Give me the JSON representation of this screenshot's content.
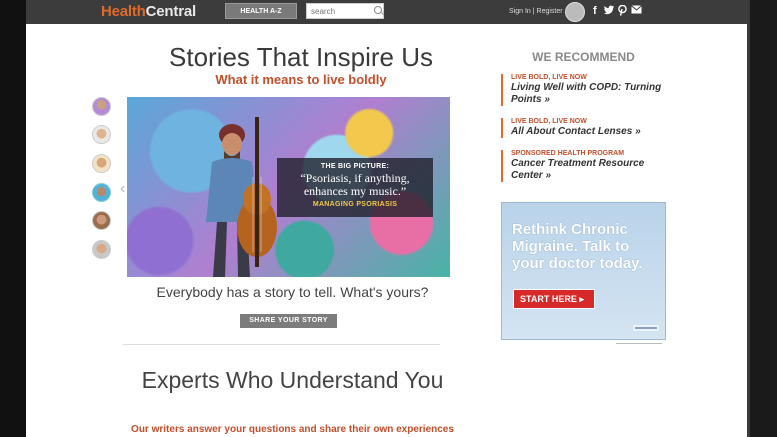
{
  "header": {
    "logo_part1": "Health",
    "logo_part2": "Central",
    "health_az_label": "HEALTH A-Z",
    "search_placeholder": "search",
    "signin_label": "Sign In",
    "separator": "|",
    "register_label": "Register",
    "social_icons": [
      "facebook-icon",
      "twitter-icon",
      "pinterest-icon",
      "email-icon"
    ]
  },
  "stories": {
    "title": "Stories That Inspire Us",
    "subtitle": "What it means to live boldly",
    "hero": {
      "kicker": "THE BIG PICTURE:",
      "quote": "“Psoriasis, if anything, enhances my music.”",
      "tag": "MANAGING PSORIASIS"
    },
    "tagline": "Everybody has a story to tell. What's yours?",
    "share_label": "SHARE YOUR STORY"
  },
  "experts": {
    "title": "Experts Who Understand You",
    "subtitle": "Our writers answer your questions and share their own experiences"
  },
  "recommend": {
    "title": "WE RECOMMEND",
    "items": [
      {
        "kicker": "LIVE BOLD, LIVE NOW",
        "link": "Living Well with COPD: Turning Points »"
      },
      {
        "kicker": "LIVE BOLD, LIVE NOW",
        "link": "All About Contact Lenses »"
      },
      {
        "kicker": "SPONSORED HEALTH PROGRAM",
        "link": "Cancer Treatment Resource Center »"
      }
    ]
  },
  "ad": {
    "headline": "Rethink Chronic Migraine. Talk to your doctor today.",
    "button_label": "START HERE ▸",
    "brand": "ALLERGAN"
  },
  "colors": {
    "accent": "#c0502b",
    "topbar": "#3c3c3c",
    "ad_button": "#d62a2a"
  }
}
